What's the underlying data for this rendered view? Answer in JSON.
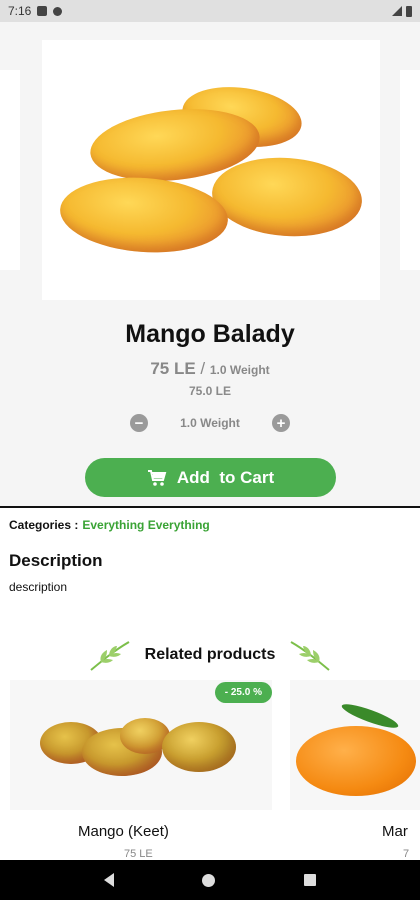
{
  "status_bar": {
    "time": "7:16"
  },
  "product": {
    "name": "Mango Balady",
    "price": "75 LE",
    "separator": " / ",
    "unit": "1.0 Weight",
    "subtotal": "75.0 LE",
    "quantity": "1.0 Weight",
    "add_to_cart_label": "Add  to Cart"
  },
  "meta": {
    "categories_label": "Categories :",
    "categories_value": "Everything Everything",
    "description_title": "Description",
    "description_text": "description"
  },
  "related": {
    "title": "Related products",
    "items": [
      {
        "name": "Mango (Keet)",
        "price": "75 LE",
        "badge": "- 25.0 %"
      },
      {
        "name": "Mar",
        "price": "7"
      }
    ]
  },
  "colors": {
    "accent": "#4caf50",
    "category_link": "#3aa335"
  },
  "icons": {
    "cart": "cart-icon",
    "minus": "minus-icon",
    "plus": "plus-icon",
    "leaf": "leaf-icon"
  }
}
